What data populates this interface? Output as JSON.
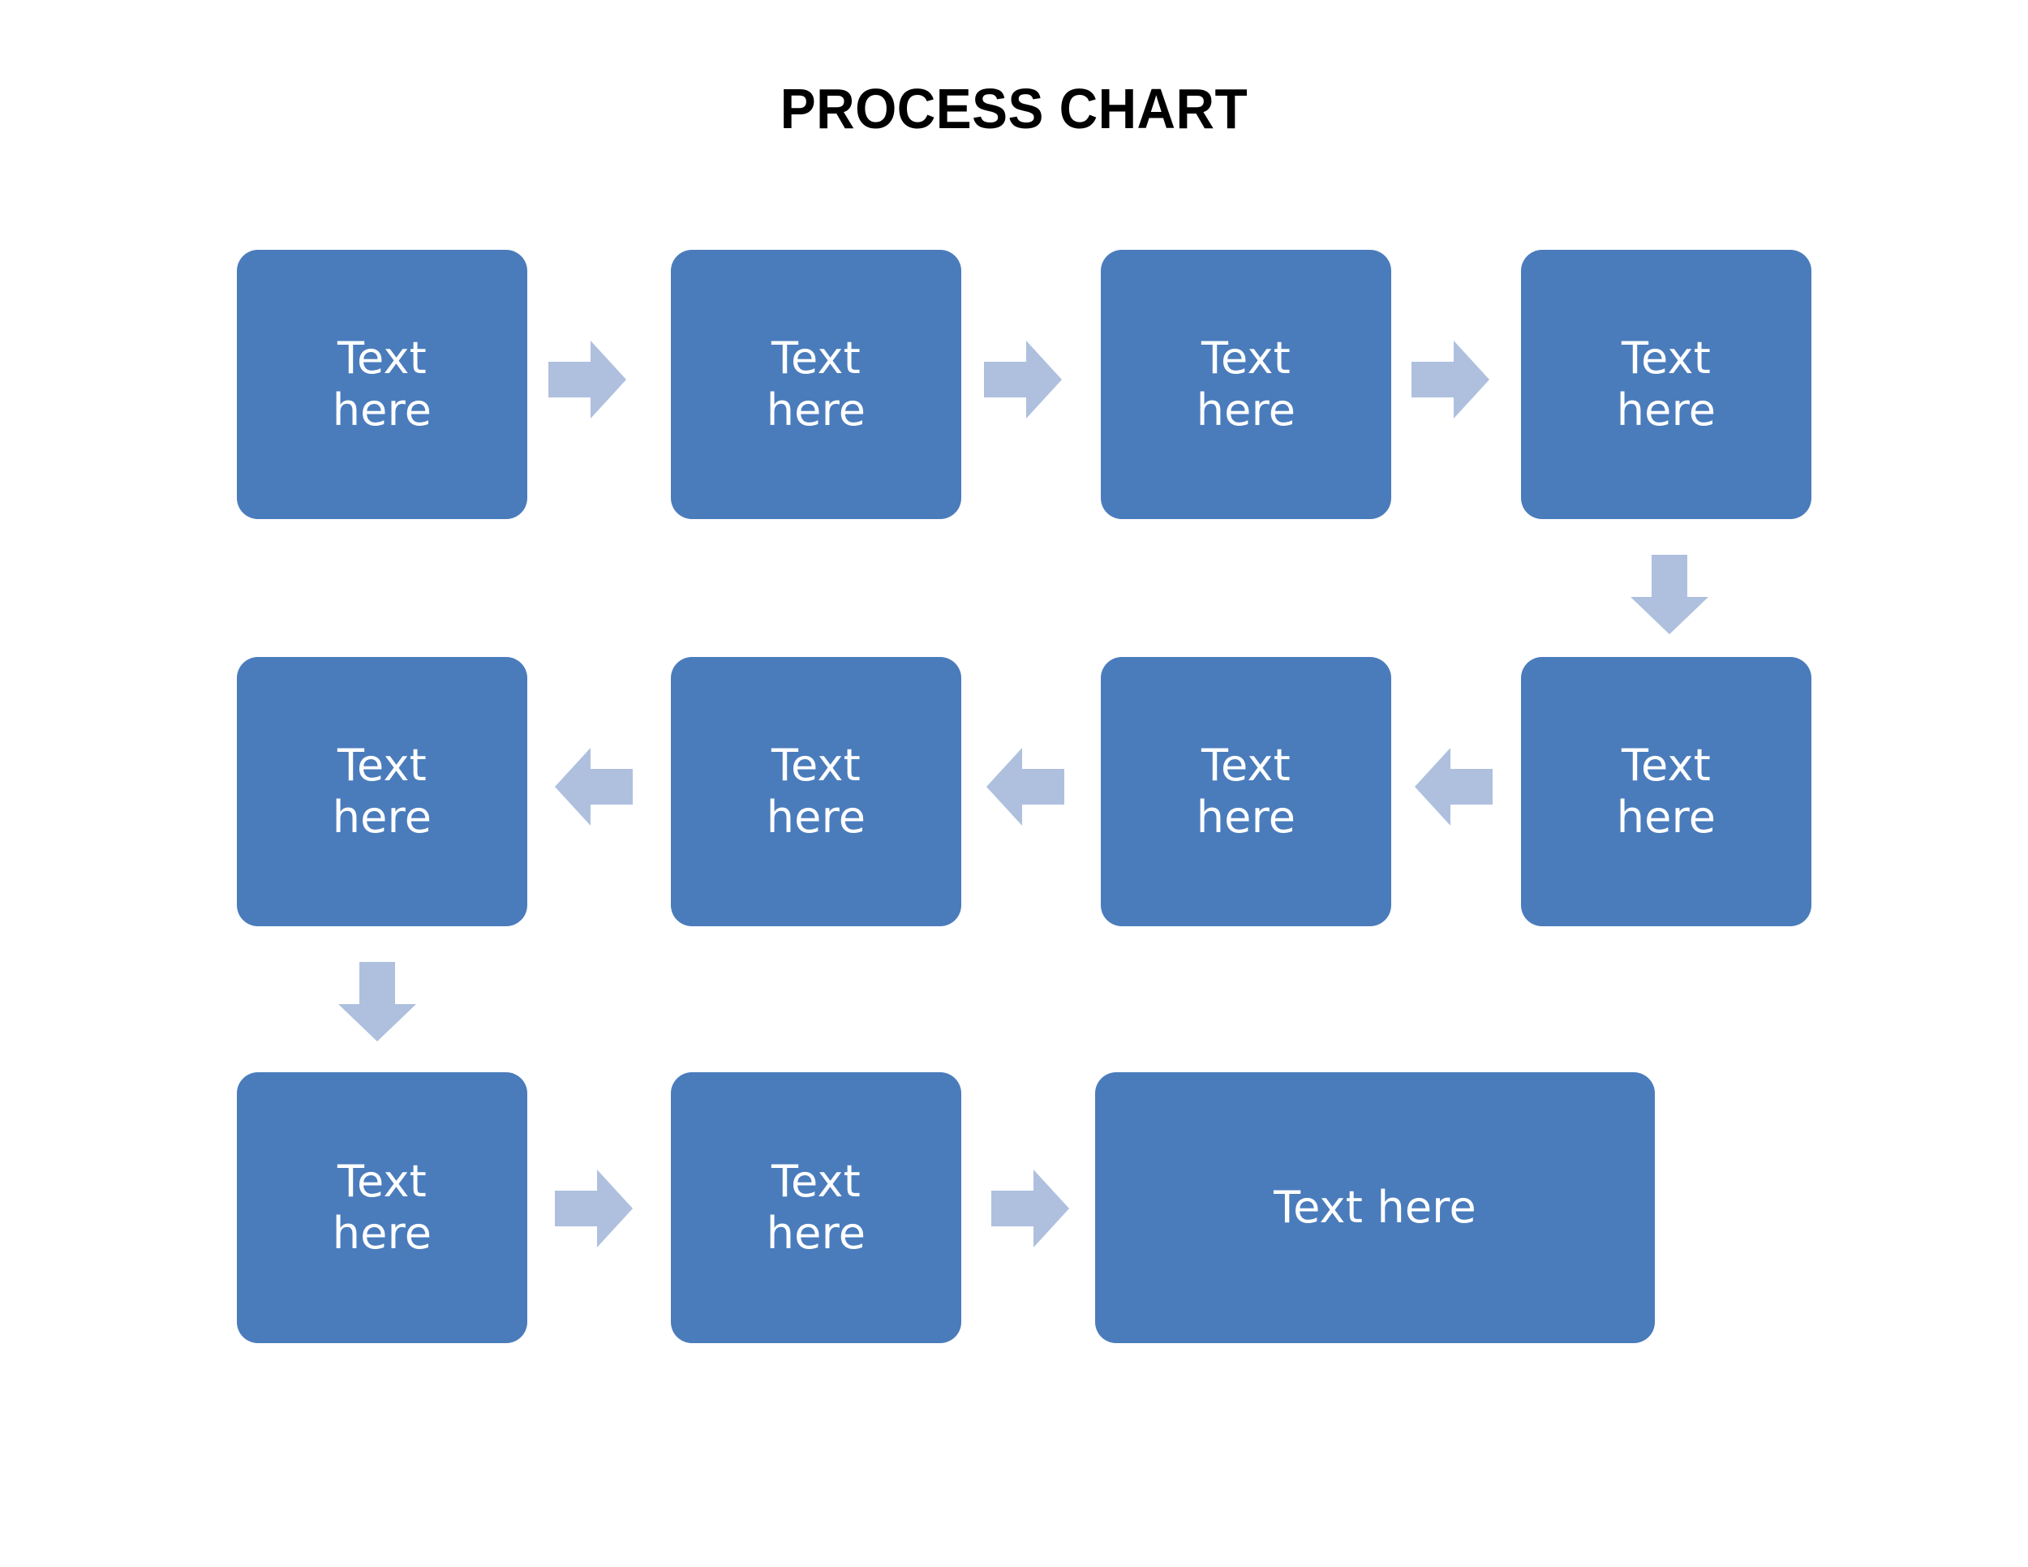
{
  "document": {
    "title": "PROCESS CHART",
    "background_color": "#FFFFFF"
  },
  "theme": {
    "box_fill": "#4A7CBC",
    "box_text_color": "#FFFFFF",
    "arrow_fill": "#AEC0DE",
    "title_color": "#000000"
  },
  "chart_data": {
    "type": "diagram",
    "diagram_kind": "process-flow",
    "title": "PROCESS CHART",
    "flow_direction": "serpentine (row 1 left-to-right, row 2 right-to-left, row 3 left-to-right)",
    "node_label": "Text here",
    "node_count": 11,
    "rows": [
      {
        "row_index": 1,
        "direction": "left-to-right",
        "node_count": 4,
        "connector_count": 3,
        "connector_type": "arrow-right"
      },
      {
        "row_index": 2,
        "direction": "right-to-left",
        "node_count": 4,
        "connector_count": 3,
        "connector_type": "arrow-left"
      },
      {
        "row_index": 3,
        "direction": "left-to-right",
        "node_count": 3,
        "connector_count": 2,
        "connector_type": "arrow-right"
      }
    ],
    "row_connectors": [
      {
        "from_row": 1,
        "to_row": 2,
        "column": 4,
        "connector_type": "arrow-down"
      },
      {
        "from_row": 2,
        "to_row": 3,
        "column": 1,
        "connector_type": "arrow-down"
      }
    ]
  },
  "rows": [
    {
      "id": "row-1",
      "nodes": [
        {
          "id": "r1n1",
          "label": "Text\nhere"
        },
        {
          "id": "r1n2",
          "label": "Text\nhere"
        },
        {
          "id": "r1n3",
          "label": "Text\nhere"
        },
        {
          "id": "r1n4",
          "label": "Text\nhere"
        }
      ]
    },
    {
      "id": "row-2",
      "nodes": [
        {
          "id": "r2n1",
          "label": "Text\nhere"
        },
        {
          "id": "r2n2",
          "label": "Text\nhere"
        },
        {
          "id": "r2n3",
          "label": "Text\nhere"
        },
        {
          "id": "r2n4",
          "label": "Text\nhere"
        }
      ]
    },
    {
      "id": "row-3",
      "nodes": [
        {
          "id": "r3n1",
          "label": "Text\nhere"
        },
        {
          "id": "r3n2",
          "label": "Text\nhere"
        },
        {
          "id": "r3n3",
          "label": "Text here"
        }
      ]
    }
  ],
  "icons": {
    "arrow_right": "arrow-right-icon",
    "arrow_left": "arrow-left-icon",
    "arrow_down": "arrow-down-icon"
  }
}
